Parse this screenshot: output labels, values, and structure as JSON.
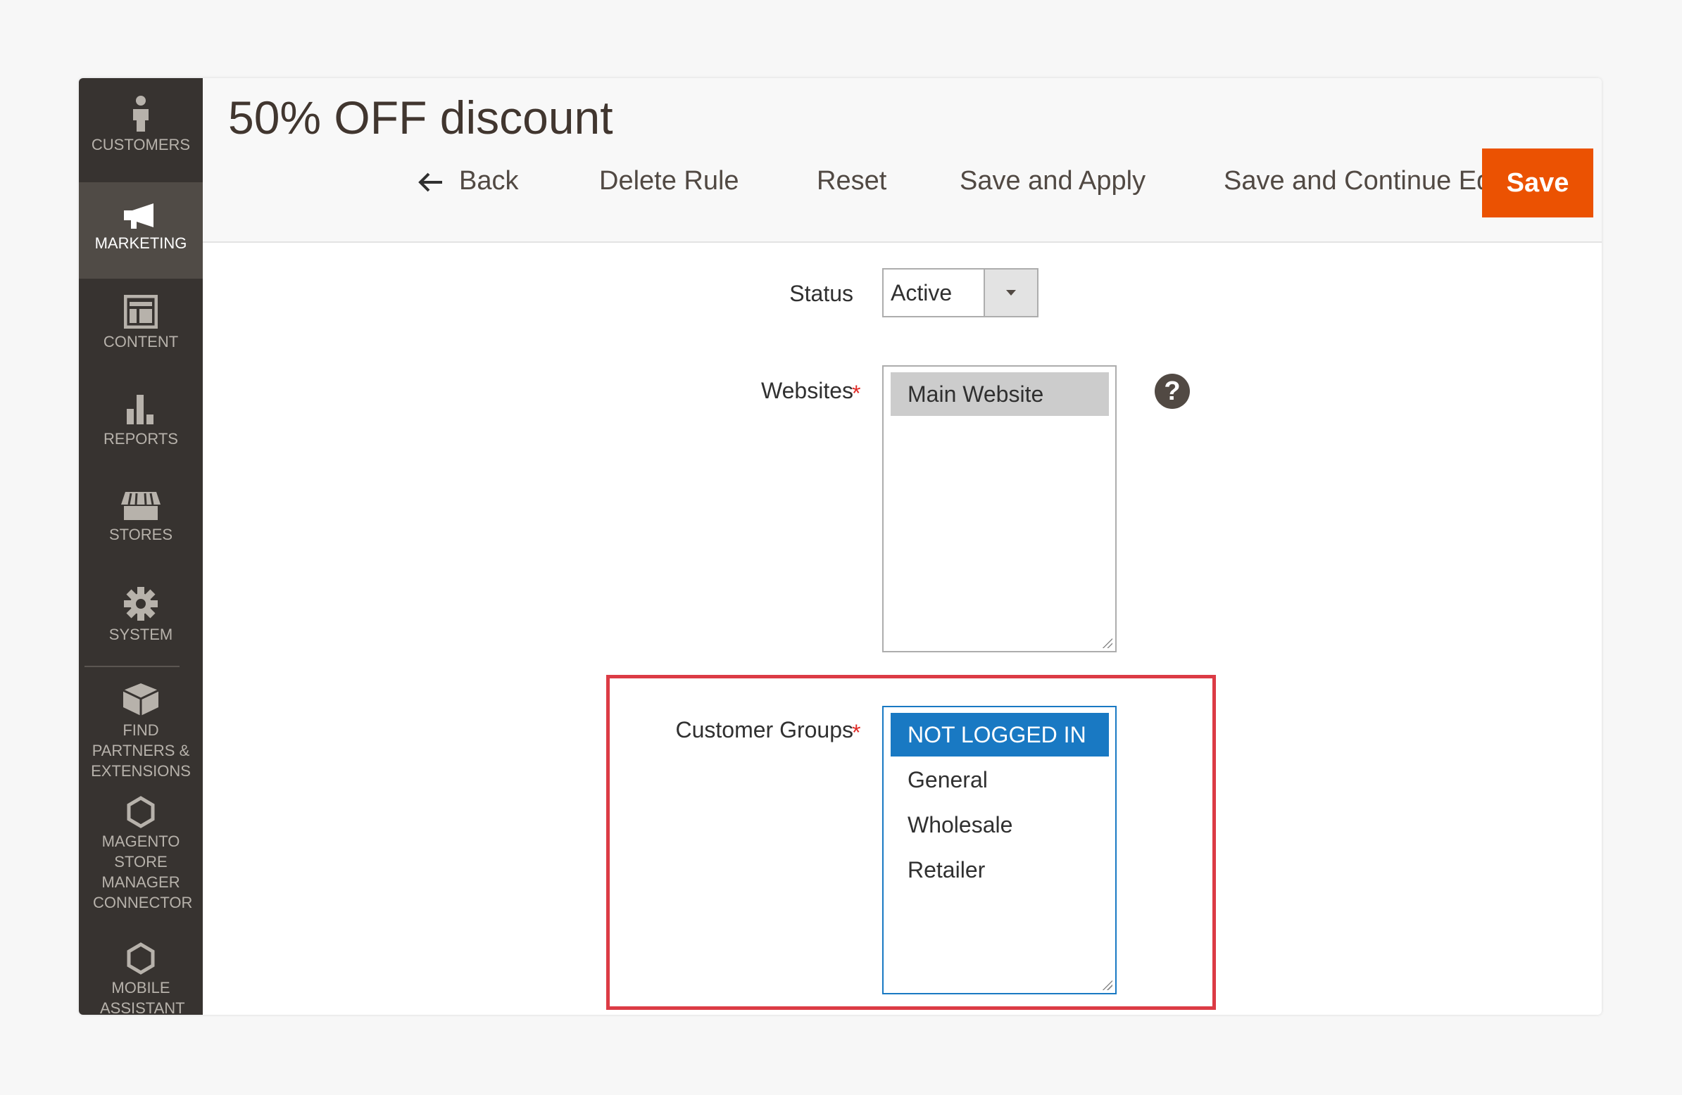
{
  "sidebar": {
    "items": [
      {
        "label": "CUSTOMERS",
        "icon": "person-icon"
      },
      {
        "label": "MARKETING",
        "icon": "megaphone-icon",
        "active": true
      },
      {
        "label": "CONTENT",
        "icon": "layout-icon"
      },
      {
        "label": "REPORTS",
        "icon": "bar-chart-icon"
      },
      {
        "label": "STORES",
        "icon": "store-icon"
      },
      {
        "label": "SYSTEM",
        "icon": "gear-icon"
      },
      {
        "label": "FIND PARTNERS & EXTENSIONS",
        "icon": "blocks-icon"
      },
      {
        "label": "MAGENTO STORE MANAGER CONNECTOR",
        "icon": "hexagon-icon"
      },
      {
        "label": "MOBILE ASSISTANT",
        "icon": "hexagon-icon"
      }
    ]
  },
  "header": {
    "title": "50% OFF discount",
    "back_label": "Back",
    "delete_label": "Delete Rule",
    "reset_label": "Reset",
    "save_apply_label": "Save and Apply",
    "save_continue_label": "Save and Continue Edit",
    "save_label": "Save"
  },
  "form": {
    "status": {
      "label": "Status",
      "value": "Active"
    },
    "websites": {
      "label": "Websites",
      "required": "*",
      "options": [
        "Main Website"
      ],
      "selected": "Main Website",
      "help": "?"
    },
    "customer_groups": {
      "label": "Customer Groups",
      "required": "*",
      "options": [
        "NOT LOGGED IN",
        "General",
        "Wholesale",
        "Retailer"
      ],
      "selected": "NOT LOGGED IN"
    }
  },
  "colors": {
    "accent": "#eb5202",
    "sidebar_bg": "#373330",
    "selection": "#1979c3",
    "highlight_border": "#dc3b45"
  }
}
